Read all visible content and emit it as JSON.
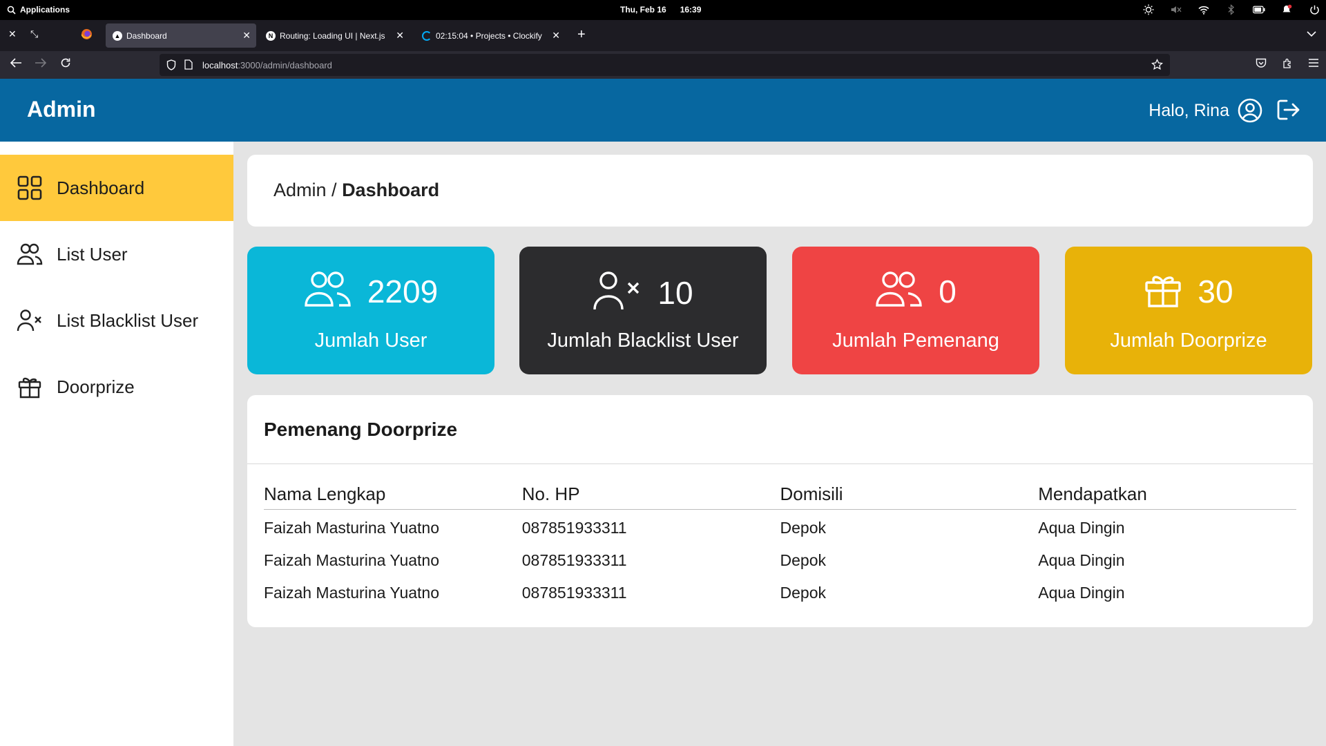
{
  "os": {
    "apps_label": "Applications",
    "date": "Thu, Feb 16",
    "time": "16:39"
  },
  "browser": {
    "tabs": [
      {
        "label": "Dashboard",
        "active": true
      },
      {
        "label": "Routing: Loading UI | Next.js",
        "active": false
      },
      {
        "label": "02:15:04 • Projects • Clockify",
        "active": false
      }
    ],
    "url_host": "localhost",
    "url_rest": ":3000/admin/dashboard"
  },
  "header": {
    "brand": "Admin",
    "greeting": "Halo, Rina"
  },
  "sidebar": {
    "items": [
      {
        "label": "Dashboard",
        "icon": "grid-icon",
        "active": true
      },
      {
        "label": "List User",
        "icon": "users-icon",
        "active": false
      },
      {
        "label": "List Blacklist User",
        "icon": "user-x-icon",
        "active": false
      },
      {
        "label": "Doorprize",
        "icon": "gift-icon",
        "active": false
      }
    ]
  },
  "breadcrumb": {
    "parent": "Admin /",
    "current": "Dashboard"
  },
  "stats": [
    {
      "value": "2209",
      "label": "Jumlah User",
      "icon": "users-icon",
      "color": "#0ab7d8"
    },
    {
      "value": "10",
      "label": "Jumlah Blacklist User",
      "icon": "user-x-icon",
      "color": "#2c2c2e"
    },
    {
      "value": "0",
      "label": "Jumlah Pemenang",
      "icon": "users-icon",
      "color": "#ef4444"
    },
    {
      "value": "30",
      "label": "Jumlah Doorprize",
      "icon": "gift-icon",
      "color": "#e8b209"
    }
  ],
  "winners": {
    "title": "Pemenang Doorprize",
    "columns": [
      "Nama Lengkap",
      "No. HP",
      "Domisili",
      "Mendapatkan"
    ],
    "rows": [
      [
        "Faizah Masturina Yuatno",
        "087851933311",
        "Depok",
        "Aqua Dingin"
      ],
      [
        "Faizah Masturina Yuatno",
        "087851933311",
        "Depok",
        "Aqua Dingin"
      ],
      [
        "Faizah Masturina Yuatno",
        "087851933311",
        "Depok",
        "Aqua Dingin"
      ]
    ]
  }
}
